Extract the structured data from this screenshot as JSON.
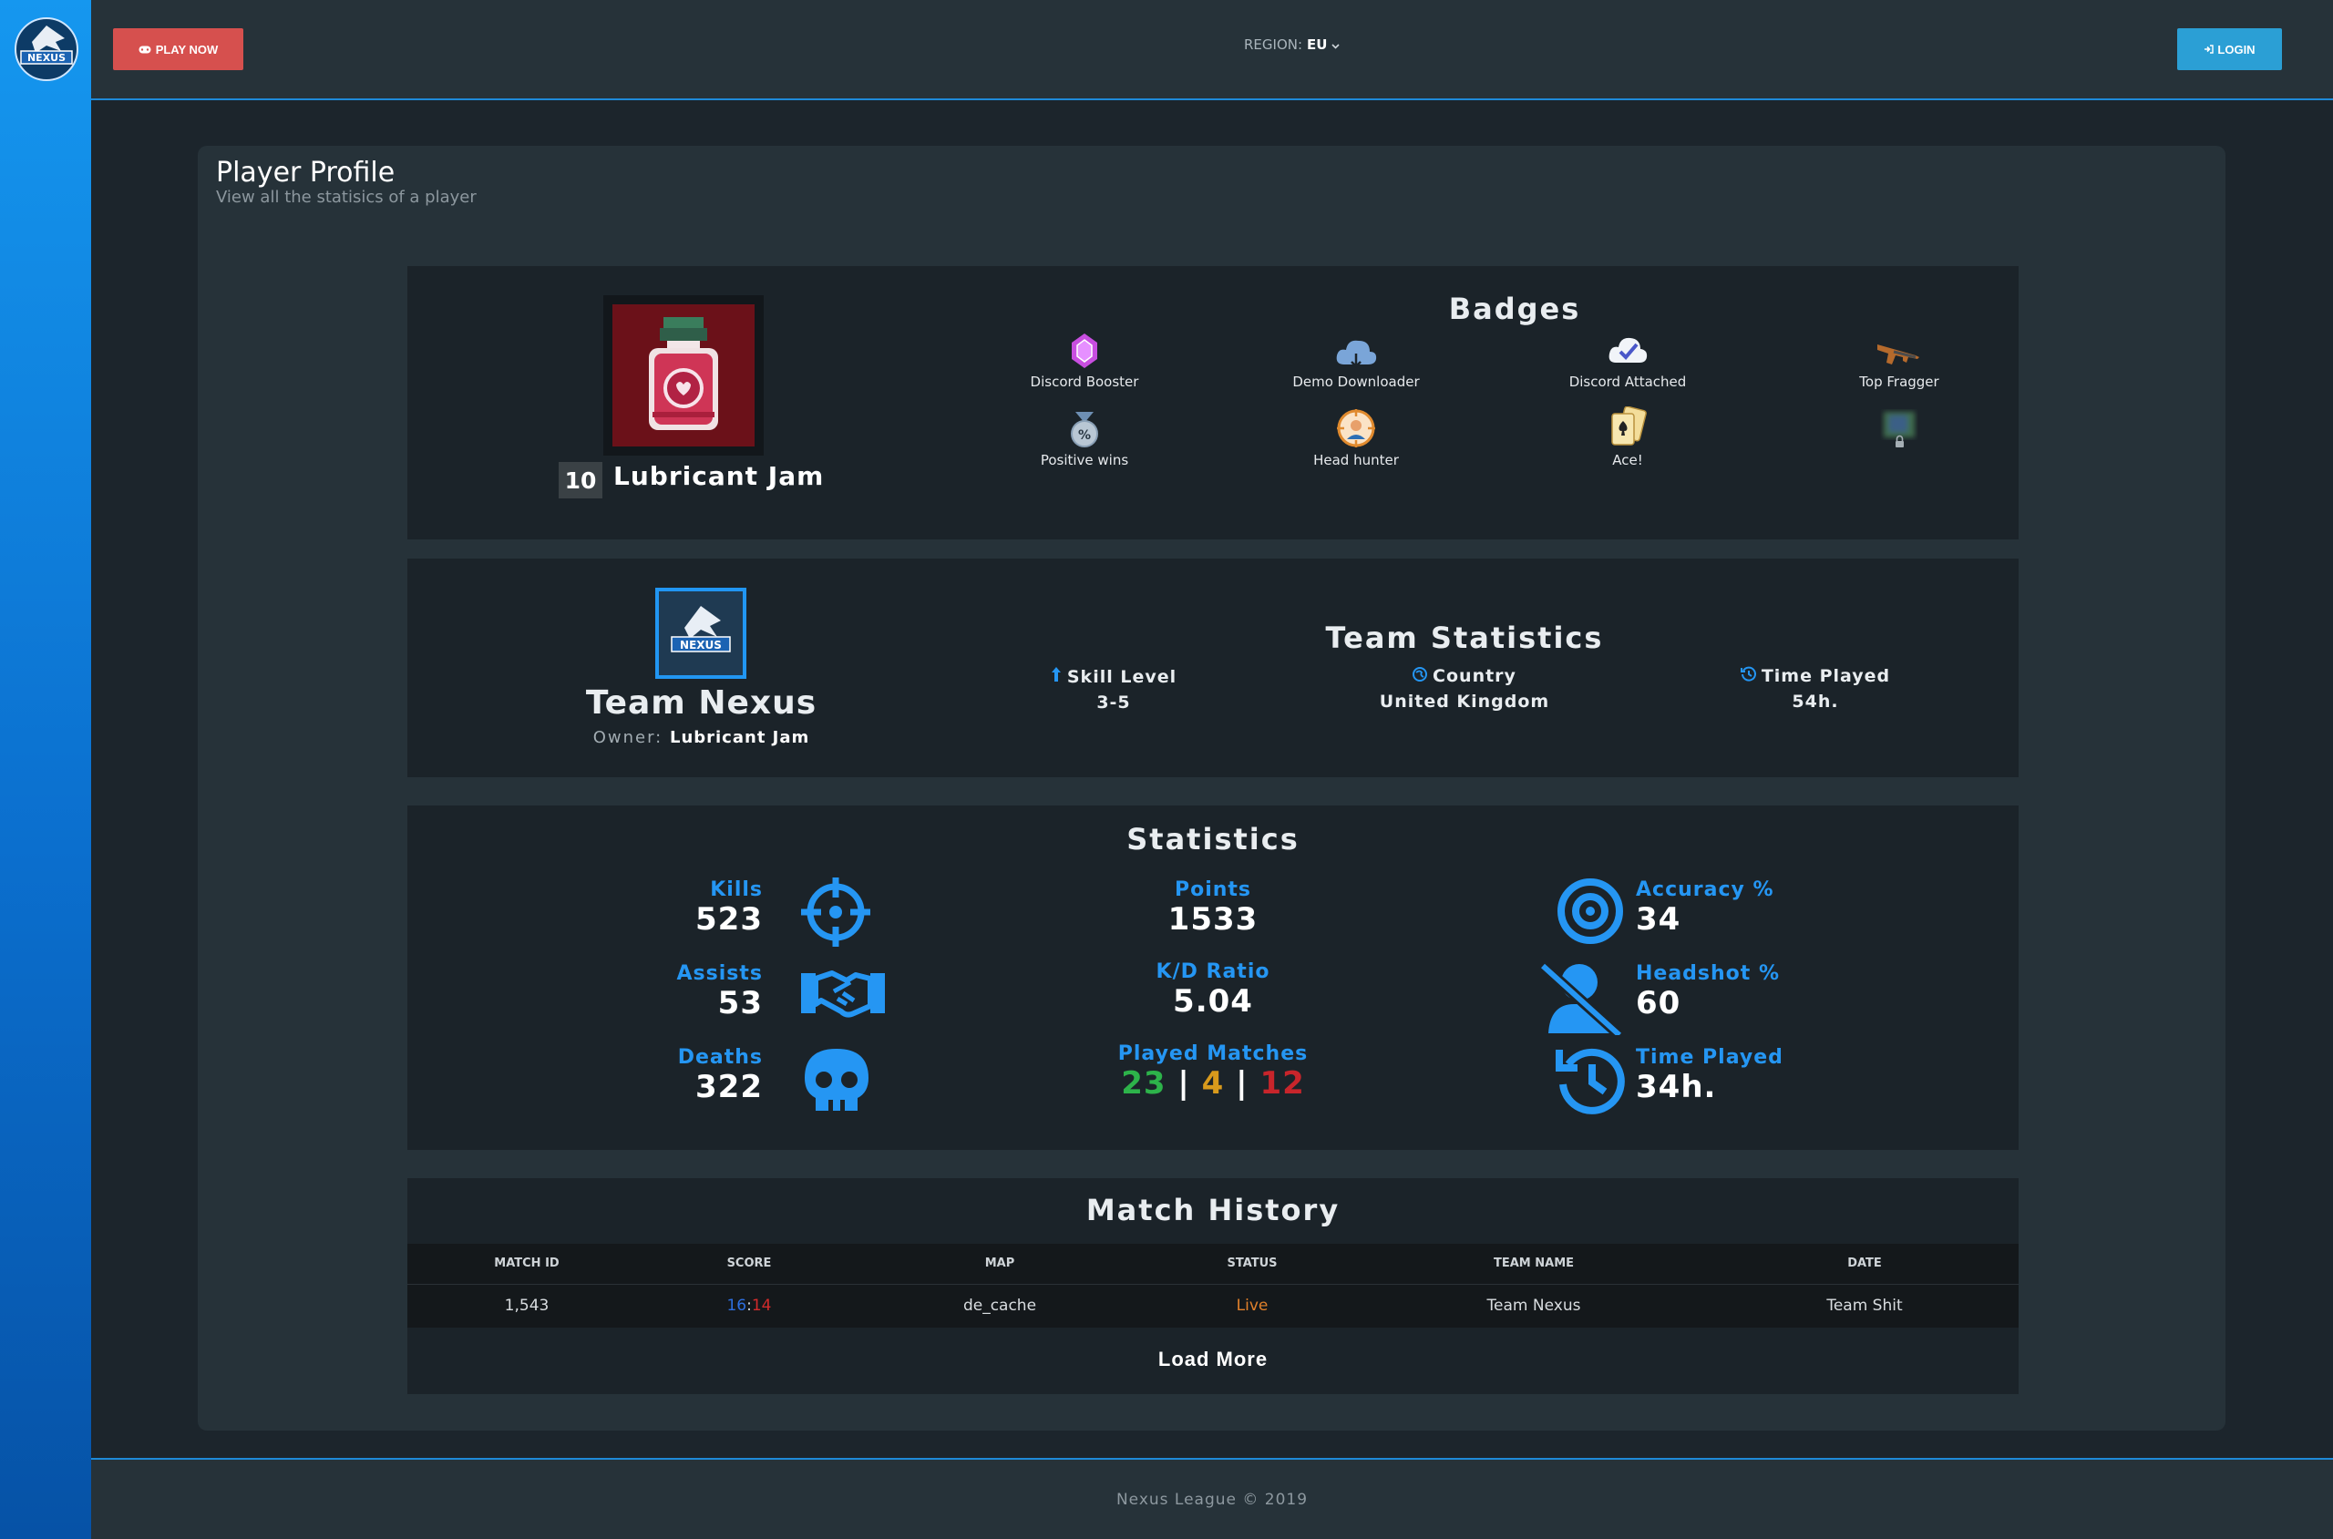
{
  "header": {
    "play_label": "PLAY NOW",
    "region_label": "REGION:",
    "region_value": "EU",
    "login_label": "LOGIN"
  },
  "page": {
    "title": "Player Profile",
    "subtitle": "View all the statisics of a player"
  },
  "player": {
    "level": "10",
    "name": "Lubricant Jam"
  },
  "badges": {
    "title": "Badges",
    "items": [
      {
        "label": "Discord Booster",
        "icon": "gem-icon"
      },
      {
        "label": "Demo Downloader",
        "icon": "cloud-download-icon"
      },
      {
        "label": "Discord Attached",
        "icon": "cloud-check-icon"
      },
      {
        "label": "Top Fragger",
        "icon": "rifle-icon"
      },
      {
        "label": "Positive wins",
        "icon": "medal-percent-icon"
      },
      {
        "label": "Head hunter",
        "icon": "crosshair-head-icon"
      },
      {
        "label": "Ace!",
        "icon": "cards-ace-icon"
      },
      {
        "label": "",
        "icon": "locked-badge-icon"
      }
    ]
  },
  "team": {
    "name": "Team Nexus",
    "owner_label": "Owner:",
    "owner_name": "Lubricant Jam",
    "stats_title": "Team Statistics",
    "skill_label": "Skill Level",
    "skill_value": "3-5",
    "country_label": "Country",
    "country_value": "United Kingdom",
    "time_label": "Time Played",
    "time_value": "54h."
  },
  "statistics": {
    "title": "Statistics",
    "kills_label": "Kills",
    "kills": "523",
    "assists_label": "Assists",
    "assists": "53",
    "deaths_label": "Deaths",
    "deaths": "322",
    "points_label": "Points",
    "points": "1533",
    "kd_label": "K/D Ratio",
    "kd": "5.04",
    "matches_label": "Played Matches",
    "wins": "23",
    "draws": "4",
    "losses": "12",
    "sep": "|",
    "accuracy_label": "Accuracy %",
    "accuracy": "34",
    "headshot_label": "Headshot %",
    "headshot": "60",
    "time_label": "Time Played",
    "time": "34h."
  },
  "match_history": {
    "title": "Match History",
    "columns": [
      "Match ID",
      "Score",
      "Map",
      "Status",
      "Team Name",
      "Date"
    ],
    "rows": [
      {
        "id": "1,543",
        "score_a": "16",
        "score_sep": ":",
        "score_b": "14",
        "map": "de_cache",
        "status": "Live",
        "team": "Team Nexus",
        "date": "Team Shit"
      }
    ],
    "load_more": "Load More"
  },
  "footer": {
    "text": "Nexus League © 2019"
  },
  "colors": {
    "accent": "#2596f3",
    "play_button": "#d6504e",
    "login_button": "#2b9fd5",
    "win": "#2db34a",
    "draw": "#d89a1c",
    "loss": "#c8252b",
    "status_live": "#e0802b"
  }
}
